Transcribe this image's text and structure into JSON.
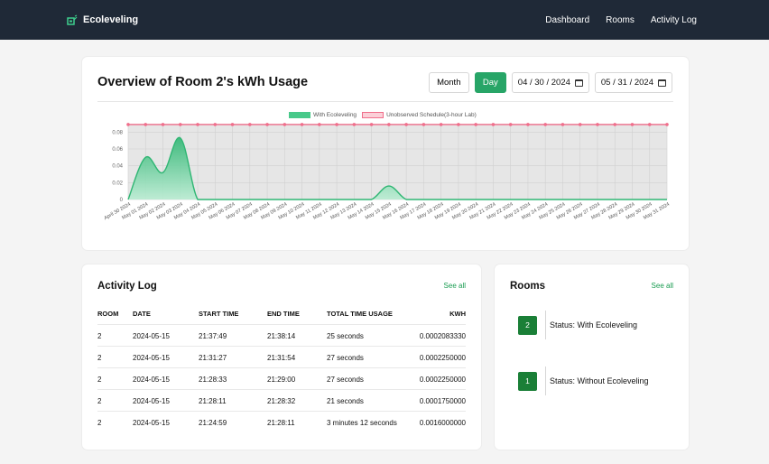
{
  "nav": {
    "brand": "Ecoleveling",
    "links": [
      "Dashboard",
      "Rooms",
      "Activity Log"
    ]
  },
  "overview": {
    "title": "Overview of Room 2's kWh Usage",
    "month_label": "Month",
    "day_label": "Day",
    "start_date": "04 / 30 / 2024",
    "end_date": "05 / 31 / 2024"
  },
  "colors": {
    "accent": "#27a567",
    "navbar": "#1f2937",
    "series_green": "#48c98a",
    "series_red": "#f06e8b"
  },
  "chart_data": {
    "type": "area",
    "categories": [
      "April 30 2024",
      "May 01 2024",
      "May 02 2024",
      "May 03 2024",
      "May 04 2024",
      "May 05 2024",
      "May 06 2024",
      "May 07 2024",
      "May 08 2024",
      "May 09 2024",
      "May 10 2024",
      "May 11 2024",
      "May 12 2024",
      "May 13 2024",
      "May 14 2024",
      "May 15 2024",
      "May 16 2024",
      "May 17 2024",
      "May 18 2024",
      "May 19 2024",
      "May 20 2024",
      "May 21 2024",
      "May 22 2024",
      "May 23 2024",
      "May 24 2024",
      "May 25 2024",
      "May 26 2024",
      "May 27 2024",
      "May 28 2024",
      "May 29 2024",
      "May 30 2024",
      "May 31 2024"
    ],
    "yticks": [
      "0",
      "0.02",
      "0.04",
      "0.06",
      "0.08"
    ],
    "ylim": [
      0,
      0.09
    ],
    "series": [
      {
        "name": "With Ecoleveling",
        "values": [
          0,
          0.05,
          0.032,
          0.073,
          0,
          0,
          0,
          0,
          0,
          0,
          0,
          0,
          0,
          0,
          0,
          0.016,
          0,
          0,
          0,
          0,
          0,
          0,
          0,
          0,
          0,
          0,
          0,
          0,
          0,
          0,
          0,
          0
        ]
      },
      {
        "name": "Unobserved Schedule(3-hour Lab)",
        "values": [
          0.089,
          0.089,
          0.089,
          0.089,
          0.089,
          0.089,
          0.089,
          0.089,
          0.089,
          0.089,
          0.089,
          0.089,
          0.089,
          0.089,
          0.089,
          0.089,
          0.089,
          0.089,
          0.089,
          0.089,
          0.089,
          0.089,
          0.089,
          0.089,
          0.089,
          0.089,
          0.089,
          0.089,
          0.089,
          0.089,
          0.089,
          0.089
        ]
      }
    ],
    "legend_position": "top-center",
    "grid": true
  },
  "activity_log": {
    "title": "Activity Log",
    "see_all": "See all",
    "headers": {
      "room": "ROOM",
      "date": "DATE",
      "start": "START TIME",
      "end": "END TIME",
      "total": "TOTAL TIME USAGE",
      "kwh": "KWH"
    },
    "rows": [
      {
        "room": "2",
        "date": "2024-05-15",
        "start": "21:37:49",
        "end": "21:38:14",
        "total": "25 seconds",
        "kwh": "0.0002083330"
      },
      {
        "room": "2",
        "date": "2024-05-15",
        "start": "21:31:27",
        "end": "21:31:54",
        "total": "27 seconds",
        "kwh": "0.0002250000"
      },
      {
        "room": "2",
        "date": "2024-05-15",
        "start": "21:28:33",
        "end": "21:29:00",
        "total": "27 seconds",
        "kwh": "0.0002250000"
      },
      {
        "room": "2",
        "date": "2024-05-15",
        "start": "21:28:11",
        "end": "21:28:32",
        "total": "21 seconds",
        "kwh": "0.0001750000"
      },
      {
        "room": "2",
        "date": "2024-05-15",
        "start": "21:24:59",
        "end": "21:28:11",
        "total": "3 minutes 12 seconds",
        "kwh": "0.0016000000"
      }
    ]
  },
  "rooms": {
    "title": "Rooms",
    "see_all": "See all",
    "items": [
      {
        "number": "2",
        "status": "Status: With Ecoleveling"
      },
      {
        "number": "1",
        "status": "Status: Without Ecoleveling"
      }
    ]
  }
}
